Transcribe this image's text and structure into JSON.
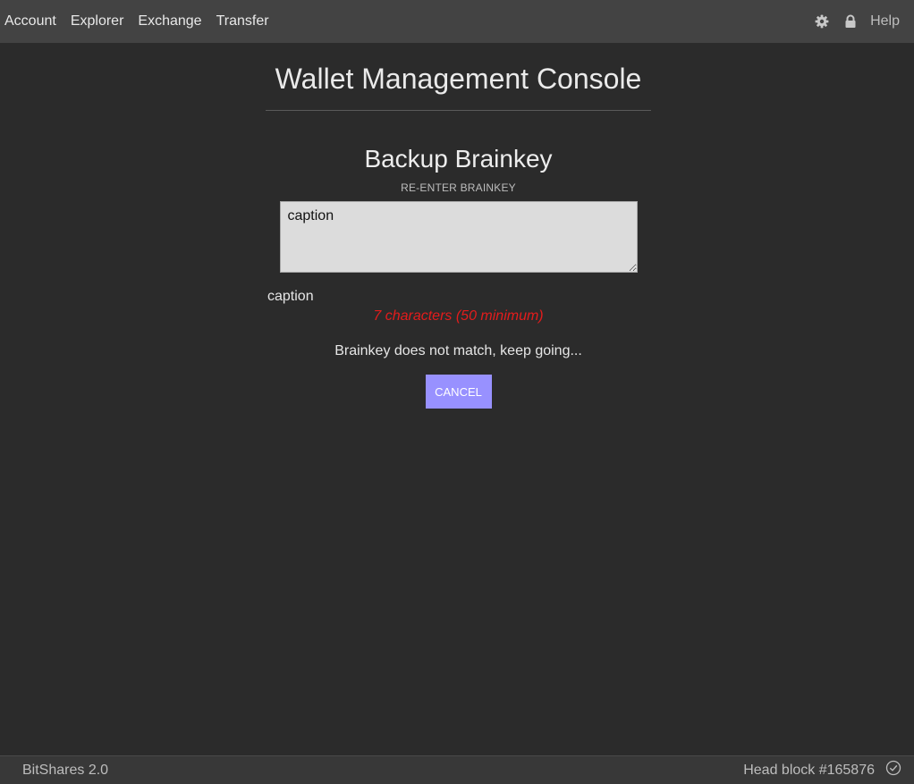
{
  "nav": {
    "items": [
      {
        "label": "Account"
      },
      {
        "label": "Explorer"
      },
      {
        "label": "Exchange"
      },
      {
        "label": "Transfer"
      }
    ],
    "help_label": "Help",
    "icons": {
      "settings": "gear-icon",
      "lock": "lock-icon"
    }
  },
  "page": {
    "title": "Wallet Management Console",
    "section_title": "Backup Brainkey",
    "field_label": "RE-ENTER BRAINKEY",
    "input_value": "caption",
    "echo_text": "caption",
    "char_count": "7 characters (50 minimum)",
    "match_status": "Brainkey does not match, keep going...",
    "cancel_label": "Cancel"
  },
  "footer": {
    "version": "BitShares 2.0",
    "head_block": "Head block #165876",
    "sync_icon": "check-circle-icon"
  },
  "colors": {
    "background": "#2b2b2b",
    "topbar": "#434343",
    "accent_button": "#9891ff",
    "error": "#e41c1c"
  }
}
